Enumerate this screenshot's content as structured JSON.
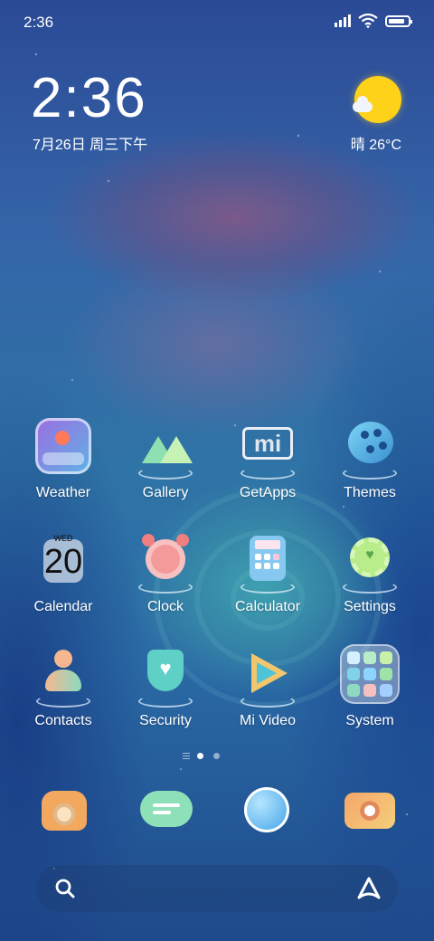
{
  "status_bar": {
    "time": "2:36",
    "battery_level": 0.85,
    "signal_bars": 4,
    "icons": [
      "signal-icon",
      "wifi-icon",
      "battery-icon"
    ]
  },
  "clock_widget": {
    "time": "2:36",
    "date": "7月26日 周三下午"
  },
  "weather_widget": {
    "icon": "sunny-icon",
    "temperature": "晴 26°C"
  },
  "apps": [
    {
      "label": "Weather",
      "icon": "weather-app-icon"
    },
    {
      "label": "Gallery",
      "icon": "gallery-app-icon"
    },
    {
      "label": "GetApps",
      "icon": "getapps-app-icon",
      "badge_text": "mi"
    },
    {
      "label": "Themes",
      "icon": "themes-app-icon"
    },
    {
      "label": "Calendar",
      "icon": "calendar-app-icon",
      "dow": "WED",
      "day": "20"
    },
    {
      "label": "Clock",
      "icon": "clock-app-icon"
    },
    {
      "label": "Calculator",
      "icon": "calculator-app-icon"
    },
    {
      "label": "Settings",
      "icon": "settings-app-icon"
    },
    {
      "label": "Contacts",
      "icon": "contacts-app-icon"
    },
    {
      "label": "Security",
      "icon": "security-app-icon"
    },
    {
      "label": "Mi Video",
      "icon": "mivideo-app-icon"
    },
    {
      "label": "System",
      "icon": "system-folder-icon"
    }
  ],
  "page_indicator": {
    "pages": 2,
    "current": 1
  },
  "dock": [
    {
      "name": "phone-icon"
    },
    {
      "name": "messages-icon"
    },
    {
      "name": "browser-icon"
    },
    {
      "name": "camera-icon"
    }
  ],
  "search_bar": {
    "left_icon": "search-icon",
    "right_icon": "assistant-icon"
  },
  "colors": {
    "accent_sun": "#ffd21a",
    "active_dot": "#ffffff",
    "inactive_dot": "rgba(255,255,255,0.5)"
  }
}
